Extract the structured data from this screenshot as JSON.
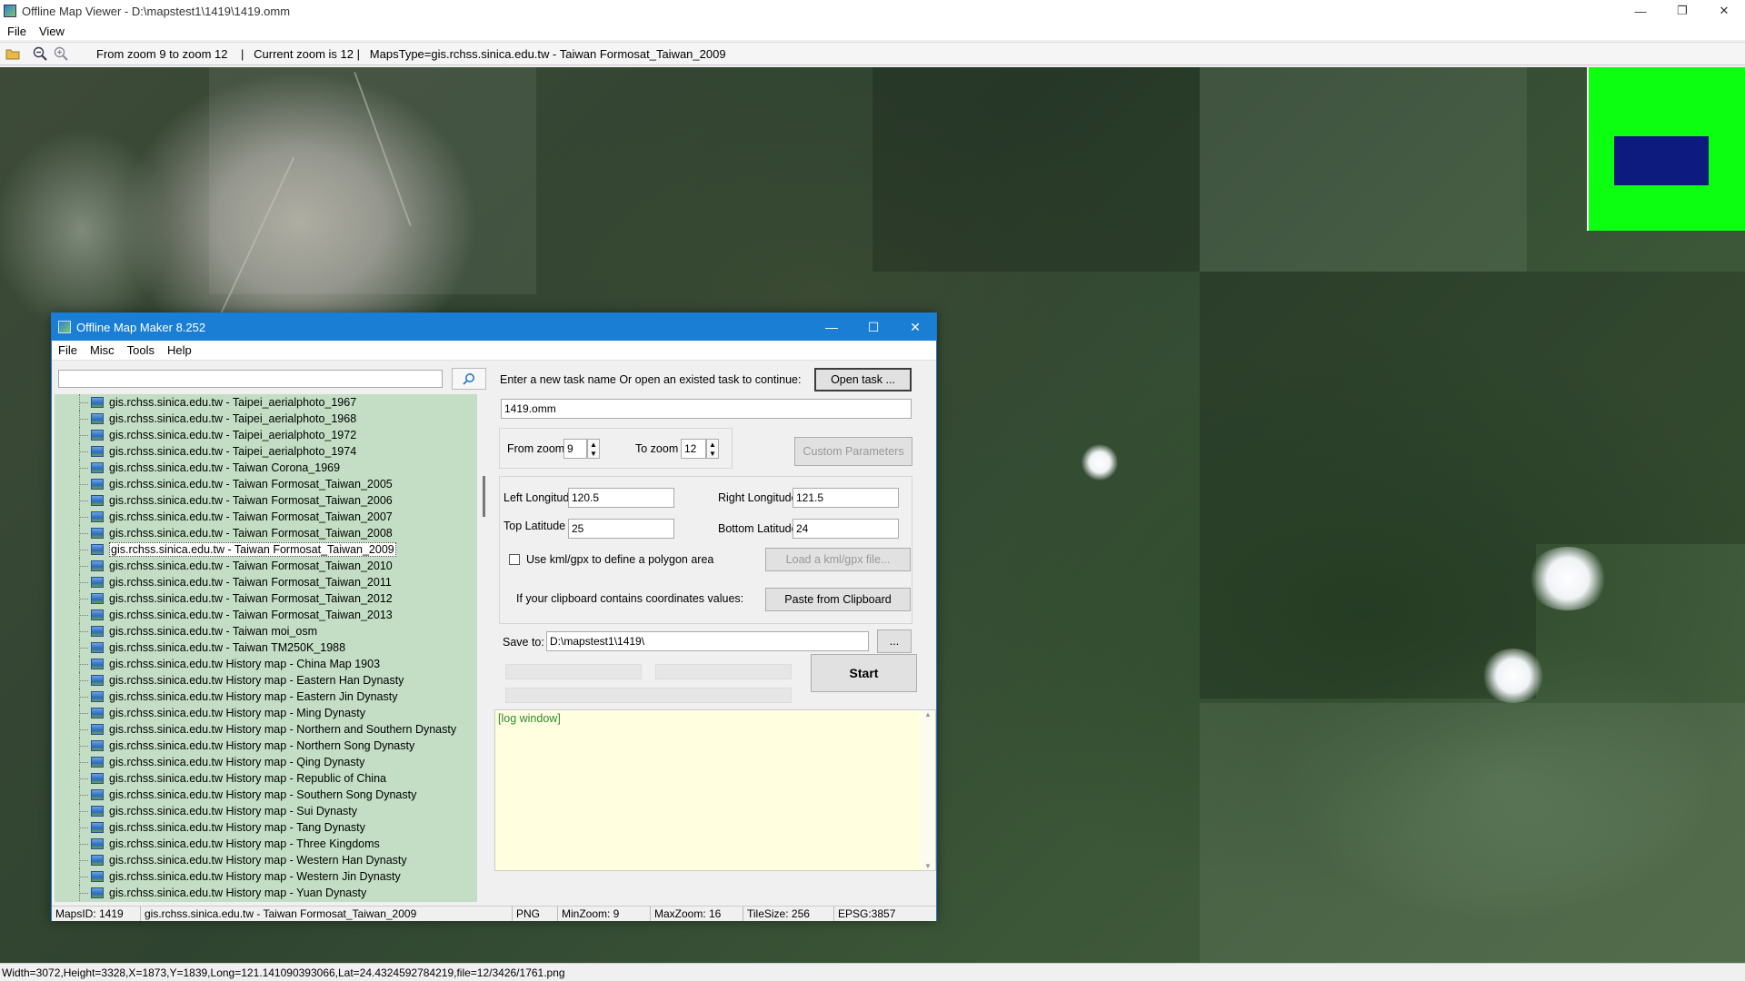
{
  "window": {
    "title": "Offline Map Viewer - D:\\mapstest1\\1419\\1419.omm",
    "controls": [
      "—",
      "❐",
      "✕"
    ]
  },
  "menubar": [
    "File",
    "View"
  ],
  "toolbar": {
    "info": "From zoom 9 to zoom 12    |   Current zoom is 12 |   MapsType=gis.rchss.sinica.edu.tw - Taiwan Formosat_Taiwan_2009"
  },
  "statusbar": {
    "text": "Width=3072,Height=3328,X=1873,Y=1839,Long=121.141090393066,Lat=24.4324592784219,file=12/3426/1761.png"
  },
  "overview": {
    "bg_color": "#0cff10",
    "viewport_color": "#0d1a7e"
  },
  "dialog": {
    "title": "Offline Map Maker 8.252",
    "controls": [
      "—",
      "☐",
      "✕"
    ],
    "menu": [
      "File",
      "Misc",
      "Tools",
      "Help"
    ],
    "search": {
      "value": "",
      "icon": "search-icon"
    },
    "tree_items": [
      "gis.rchss.sinica.edu.tw - Taipei_aerialphoto_1967",
      "gis.rchss.sinica.edu.tw - Taipei_aerialphoto_1968",
      "gis.rchss.sinica.edu.tw - Taipei_aerialphoto_1972",
      "gis.rchss.sinica.edu.tw - Taipei_aerialphoto_1974",
      "gis.rchss.sinica.edu.tw - Taiwan Corona_1969",
      "gis.rchss.sinica.edu.tw - Taiwan Formosat_Taiwan_2005",
      "gis.rchss.sinica.edu.tw - Taiwan Formosat_Taiwan_2006",
      "gis.rchss.sinica.edu.tw - Taiwan Formosat_Taiwan_2007",
      "gis.rchss.sinica.edu.tw - Taiwan Formosat_Taiwan_2008",
      "gis.rchss.sinica.edu.tw - Taiwan Formosat_Taiwan_2009",
      "gis.rchss.sinica.edu.tw - Taiwan Formosat_Taiwan_2010",
      "gis.rchss.sinica.edu.tw - Taiwan Formosat_Taiwan_2011",
      "gis.rchss.sinica.edu.tw - Taiwan Formosat_Taiwan_2012",
      "gis.rchss.sinica.edu.tw - Taiwan Formosat_Taiwan_2013",
      "gis.rchss.sinica.edu.tw - Taiwan moi_osm",
      "gis.rchss.sinica.edu.tw - Taiwan TM250K_1988",
      "gis.rchss.sinica.edu.tw History map - China Map 1903",
      "gis.rchss.sinica.edu.tw History map - Eastern Han Dynasty",
      "gis.rchss.sinica.edu.tw History map - Eastern Jin Dynasty",
      "gis.rchss.sinica.edu.tw History map - Ming Dynasty",
      "gis.rchss.sinica.edu.tw History map - Northern and Southern Dynasty",
      "gis.rchss.sinica.edu.tw History map - Northern Song Dynasty",
      "gis.rchss.sinica.edu.tw History map - Qing Dynasty",
      "gis.rchss.sinica.edu.tw History map - Republic of China",
      "gis.rchss.sinica.edu.tw History map - Southern Song Dynasty",
      "gis.rchss.sinica.edu.tw History map - Sui Dynasty",
      "gis.rchss.sinica.edu.tw History map - Tang Dynasty",
      "gis.rchss.sinica.edu.tw History map - Three Kingdoms",
      "gis.rchss.sinica.edu.tw History map - Western Han Dynasty",
      "gis.rchss.sinica.edu.tw History map - Western Jin Dynasty",
      "gis.rchss.sinica.edu.tw History map - Yuan Dynasty"
    ],
    "selected_index": 9,
    "task_prompt": "Enter a new task name Or open an existed task to continue:",
    "open_task_label": "Open task ...",
    "task_name": "1419.omm",
    "from_zoom_label": "From zoom",
    "from_zoom_value": "9",
    "to_zoom_label": "To zoom",
    "to_zoom_value": "12",
    "custom_params_label": "Custom Parameters",
    "left_longitude_label": "Left Longitude",
    "left_longitude_value": "120.5",
    "right_longitude_label": "Right Longitude",
    "right_longitude_value": "121.5",
    "top_latitude_label": "Top Latitude",
    "top_latitude_value": "25",
    "bottom_latitude_label": "Bottom Latitude",
    "bottom_latitude_value": "24",
    "use_kml_label": "Use kml/gpx to define a polygon area",
    "use_kml_checked": false,
    "load_kml_label": "Load a kml/gpx file...",
    "clipboard_prompt": "If your clipboard contains coordinates values:",
    "paste_clipboard_label": "Paste from Clipboard",
    "save_to_label": "Save to:",
    "save_to_value": "D:\\mapstest1\\1419\\",
    "browse_label": "...",
    "start_label": "Start",
    "log_text": "[log window]",
    "status": {
      "maps_id": "MapsID: 1419",
      "maps_name": "gis.rchss.sinica.edu.tw - Taiwan Formosat_Taiwan_2009",
      "format": "PNG",
      "min_zoom": "MinZoom: 9",
      "max_zoom": "MaxZoom: 16",
      "tile_size": "TileSize: 256",
      "epsg": "EPSG:3857"
    }
  }
}
